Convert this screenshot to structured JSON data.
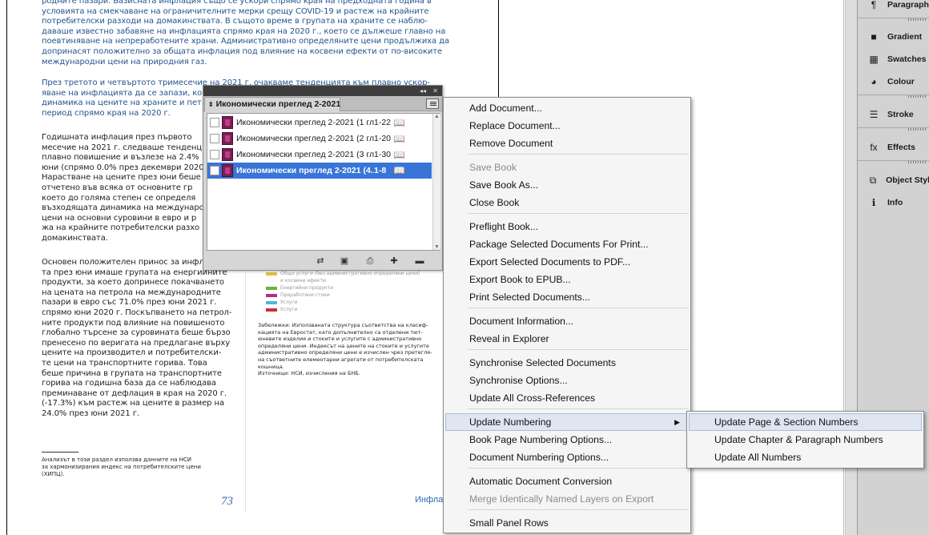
{
  "document": {
    "top_para": [
      "родните пазари. Базисната инфлация също се ускори спрямо края на предходната година в",
      "условията на смекчаване на ограничителните мерки срещу COVID-19 и растеж на крайните",
      "потребителски разходи на домакинствата. В същото време в групата на храните се наблю-",
      "даваше известно забавяне на инфлацията спрямо края на 2020 г., което се дължеше главно на",
      "поевтиняване на непреработените храни. Административно определяните цени продължиха да",
      "допринасят положително за общата инфлация под влияние на косвени ефекти от по-високите",
      "международни цени на природния газ."
    ],
    "second_para": [
      "През третото и четвъртото тримесечие на 2021 г. очакваме тенденцията към плавно ускор-",
      "яване на инфлацията да се запази, ко",
      "динамика на цените на храните и пет",
      "период спрямо края на 2020 г."
    ],
    "left_col": [
      "Годишната инфлация през първото",
      "месечие на 2021 г. следваше тенденц",
      "плавно повишение и възлезе на 2.4%",
      "юни (спрямо 0.0% през декември 2020",
      "Нарастване на цените през юни беше",
      "отчетено във всяка от основните гр",
      "което до голяма степен се определя",
      "възходящата динамика на международ",
      "цени на основни суровини в евро и р",
      "жа на крайните потребителски разхо",
      "домакинствата."
    ],
    "left_col2": [
      "Основен положителен принос за инфл",
      "та през юни имаше групата на енергийните",
      "продукти, за което допринесе покачването",
      "на цената на петрола на международните",
      "пазари в евро със 71.0% през юни 2021 г.",
      "спрямо юни 2020 г. Поскъпването на петрол-",
      "ните продукти под влияние на повишеното",
      "глобално търсене за суровината беше бързо",
      "пренесено по веригата на предлагане върху",
      "цените на производител и потребителски-",
      "те цени на транспортните горива. Това",
      "беше причина в групата на транспортните",
      "горива на годишна база да се наблюдава",
      "преминаване от дефлация в края на 2020 г.",
      "(-17.3%) към растеж на цените в размер на",
      "24.0% през юни 2021 г."
    ],
    "footnote": [
      "Анализът в този раздел използва данните на НСИ",
      "за хармонизирания индекс на потребителските цени",
      "(ХИПЦ)."
    ],
    "legend": [
      {
        "label": "Общо услуги (без административно определяни цени)",
        "color": "#e0c040"
      },
      {
        "label": "и косвени ефекти",
        "color": ""
      },
      {
        "label": "Енергийни продукти",
        "color": "#6fb04a"
      },
      {
        "label": "Преработени стоки",
        "color": "#b1307f"
      },
      {
        "label": "Услуги",
        "color": "#4fb7d8"
      },
      {
        "label": "Услуги",
        "color": "#d22b3a"
      }
    ],
    "notes": [
      "Забележки: Използваната структура съответства на класиф-",
      "кацията на Евростат, като допълнително са отделени тют-",
      "юневите изделия и стоките и услугите с административно",
      "определяни цени. Индексът на цените на стоките и услугите",
      "административно определяни цени е изчислен чрез претегля-",
      "на съответните елементарни агрегати от потребителската",
      "кошница.",
      "Източници: НСИ, изчисления на БНБ."
    ],
    "page_number": "73",
    "footer_text": "Инфлац"
  },
  "right_panel": {
    "items": [
      {
        "label": "Paragraph",
        "icon": "paragraph-icon",
        "glyph": "¶"
      },
      {
        "label": "Gradient",
        "icon": "gradient-icon",
        "glyph": "■"
      },
      {
        "label": "Swatches",
        "icon": "swatches-icon",
        "glyph": "▦"
      },
      {
        "label": "Colour",
        "icon": "colour-icon",
        "glyph": "◕"
      },
      {
        "label": "Stroke",
        "icon": "stroke-icon",
        "glyph": "☰"
      },
      {
        "label": "Effects",
        "icon": "effects-icon",
        "glyph": "fx"
      },
      {
        "label": "Object Styl",
        "icon": "object-styles-icon",
        "glyph": "⧉"
      },
      {
        "label": "Info",
        "icon": "info-icon",
        "glyph": "ℹ"
      }
    ]
  },
  "book_panel": {
    "title": "Икономически преглед 2-2021",
    "collapse_glyph": "◂◂",
    "close_glyph": "✕",
    "rows": [
      {
        "name": "Икономически преглед 2-2021 (1 гла...",
        "pages": "1-22",
        "selected": false
      },
      {
        "name": "Икономически преглед 2-2021 (2 гла...",
        "pages": "1-20",
        "selected": false
      },
      {
        "name": "Икономически преглед 2-2021 (3 гла...",
        "pages": "1-30",
        "selected": false
      },
      {
        "name": "Икономически преглед 2-2021 (4...",
        "pages": "1-8",
        "selected": true
      }
    ]
  },
  "context_menu": {
    "items": [
      {
        "label": "Add Document...",
        "disabled": false
      },
      {
        "label": "Replace Document...",
        "disabled": false
      },
      {
        "label": "Remove Document",
        "disabled": false
      },
      {
        "label": "Save Book",
        "disabled": true
      },
      {
        "label": "Save Book As...",
        "disabled": false
      },
      {
        "label": "Close Book",
        "disabled": false
      },
      {
        "label": "Preflight Book...",
        "disabled": false
      },
      {
        "label": "Package Selected Documents For Print...",
        "disabled": false
      },
      {
        "label": "Export Selected Documents to PDF...",
        "disabled": false
      },
      {
        "label": "Export Book to EPUB...",
        "disabled": false
      },
      {
        "label": "Print Selected Documents...",
        "disabled": false
      },
      {
        "label": "Document Information...",
        "disabled": false
      },
      {
        "label": "Reveal in Explorer",
        "disabled": false
      },
      {
        "label": "Synchronise Selected Documents",
        "disabled": false
      },
      {
        "label": "Synchronise Options...",
        "disabled": false
      },
      {
        "label": "Update All Cross-References",
        "disabled": false
      },
      {
        "label": "Update Numbering",
        "disabled": false,
        "highlighted": true,
        "submenu": true
      },
      {
        "label": "Book Page Numbering Options...",
        "disabled": false
      },
      {
        "label": "Document Numbering Options...",
        "disabled": false
      },
      {
        "label": "Automatic Document Conversion",
        "disabled": false
      },
      {
        "label": "Merge Identically Named Layers on Export",
        "disabled": true
      },
      {
        "label": "Small Panel Rows",
        "disabled": false
      }
    ],
    "submenu_arrow": "▶"
  },
  "sub_menu": {
    "items": [
      {
        "label": "Update Page & Section Numbers",
        "highlighted": true
      },
      {
        "label": "Update Chapter & Paragraph Numbers"
      },
      {
        "label": "Update All Numbers"
      }
    ]
  }
}
